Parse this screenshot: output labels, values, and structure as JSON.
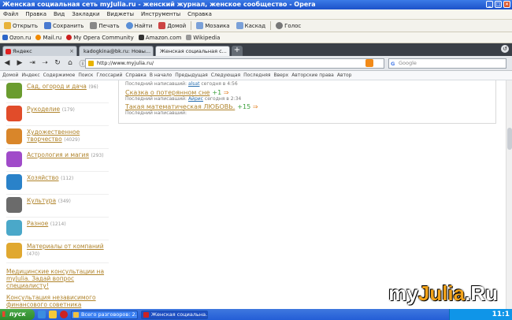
{
  "window": {
    "title": "Женская социальная сеть myJulia.ru - женский журнал, женское сообщество - Opera"
  },
  "menubar": [
    "Файл",
    "Правка",
    "Вид",
    "Закладки",
    "Виджеты",
    "Инструменты",
    "Справка"
  ],
  "toolbar": [
    "Открыть",
    "Сохранить",
    "Печать",
    "Найти",
    "Домой",
    "Мозаика",
    "Каскад",
    "Голос"
  ],
  "bookmarks": [
    "Ozon.ru",
    "Mail.ru",
    "My Opera Community",
    "Amazon.com",
    "Wikipedia"
  ],
  "tabs": [
    {
      "label": "Яндекс",
      "active": false
    },
    {
      "label": "kadogkina@bk.ru: Новы...",
      "active": false
    },
    {
      "label": "Женская социальная с...",
      "active": true
    }
  ],
  "address": {
    "url": "http://www.myjulia.ru/"
  },
  "search": {
    "placeholder": "Google"
  },
  "navigation_bar": [
    "Домой",
    "Индекс",
    "Содержимое",
    "Поиск",
    "Глоссарий",
    "Справка",
    "В начало",
    "Предыдущая",
    "Следующая",
    "Последняя",
    "Вверх",
    "Авторские права",
    "Автор"
  ],
  "sidebar": {
    "categories": [
      {
        "label": "Сад, огород и дача",
        "count": "(96)",
        "color": "#6a9c2f"
      },
      {
        "label": "Рукоделие",
        "count": "(179)",
        "color": "#e14c2a"
      },
      {
        "label": "Художественное творчество",
        "count": "(4029)",
        "color": "#d9862a"
      },
      {
        "label": "Астрология и магия",
        "count": "(293)",
        "color": "#a04bc9"
      },
      {
        "label": "Хозяйство",
        "count": "(112)",
        "color": "#2a82c9"
      },
      {
        "label": "Культура",
        "count": "(349)",
        "color": "#6b6b6b"
      },
      {
        "label": "Разное",
        "count": "(1214)",
        "color": "#4aa8c9"
      },
      {
        "label": "Материалы от компаний",
        "count": "(470)",
        "color": "#e0a830"
      }
    ],
    "links": [
      "Медицинские консультации на myJulia. Задай вопрос специалисту!",
      "Консультация независимого финансового советника"
    ]
  },
  "main": {
    "top_last_label": "Последний написавший:",
    "top_last_user": "alsat",
    "top_last_time": "сегодня в 4:56",
    "posts": [
      {
        "title": "Сказка о потерянном сне",
        "score": "+1",
        "last_label": "Последний написавший:",
        "last_user": "Айрис",
        "last_time": "сегодня в 2:34"
      },
      {
        "title": "Такая математическая ЛЮБОВЬ.",
        "score": "+15",
        "last_label": "Последний написавший:",
        "last_user": "",
        "last_time": ""
      }
    ]
  },
  "watermark": {
    "part1": "my",
    "part2": "Julia",
    "part3": ".Ru"
  },
  "taskbar": {
    "start": "пуск",
    "tasks": [
      {
        "label": "Всего разговоров: 2...",
        "active": false
      },
      {
        "label": "Женская социальна...",
        "active": true
      }
    ],
    "clock": "11:1"
  }
}
